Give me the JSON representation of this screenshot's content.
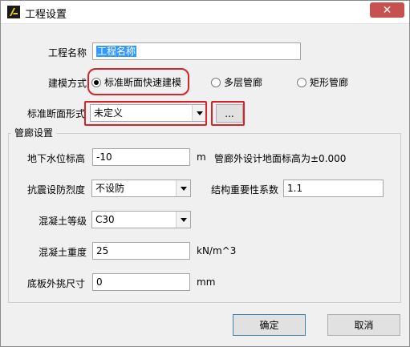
{
  "window": {
    "title": "工程设置",
    "close_symbol": "✕"
  },
  "form": {
    "project_name_label": "工程名称",
    "project_name_value": "工程名称",
    "model_method_label": "建模方式",
    "model_options": [
      {
        "label": "标准断面快速建模",
        "checked": true
      },
      {
        "label": "多层管廊",
        "checked": false
      },
      {
        "label": "矩形管廊",
        "checked": false
      }
    ],
    "section_type_label": "标准断面形式",
    "section_type_value": "未定义",
    "browse_button_label": "..."
  },
  "gallery": {
    "group_title": "管廊设置",
    "groundwater_label": "地下水位标高",
    "groundwater_value": "-10",
    "groundwater_unit": "m",
    "groundwater_note": "管廊外设计地面标高为±0.000",
    "seismic_label": "抗震设防烈度",
    "seismic_value": "不设防",
    "importance_label": "结构重要性系数",
    "importance_value": "1.1",
    "concrete_grade_label": "混凝土等级",
    "concrete_grade_value": "C30",
    "concrete_density_label": "混凝土重度",
    "concrete_density_value": "25",
    "concrete_density_unit": "kN/m^3",
    "floor_overhang_label": "底板外挑尺寸",
    "floor_overhang_value": "0",
    "floor_overhang_unit": "mm"
  },
  "actions": {
    "ok_label": "确定",
    "cancel_label": "取消"
  },
  "colors": {
    "highlight": "#d8232a",
    "selection": "#3399ff",
    "close_button": "#c75050"
  }
}
